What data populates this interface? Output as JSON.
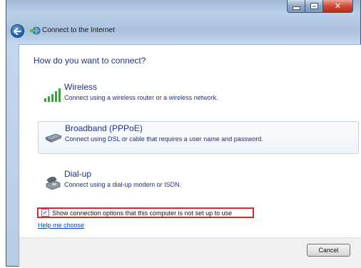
{
  "window": {
    "title": "Connect to the Internet"
  },
  "main": {
    "heading": "How do you want to connect?",
    "options": [
      {
        "title": "Wireless",
        "description": "Connect using a wireless router or a wireless network.",
        "icon": "wireless-signal-icon"
      },
      {
        "title": "Broadband (PPPoE)",
        "description": "Connect using DSL or cable that requires a user name and password.",
        "icon": "broadband-modem-icon",
        "selected": true
      },
      {
        "title": "Dial-up",
        "description": "Connect using a dial-up modem or ISDN.",
        "icon": "dialup-telephone-icon"
      }
    ],
    "show_options_label": "Show connection options that this computer is not set up to use",
    "show_options_checked": true,
    "help_link": "Help me choose"
  },
  "footer": {
    "cancel_label": "Cancel"
  },
  "colors": {
    "heading_text": "#1e3287",
    "highlight_border": "#d8262a",
    "link": "#0d46b5"
  }
}
